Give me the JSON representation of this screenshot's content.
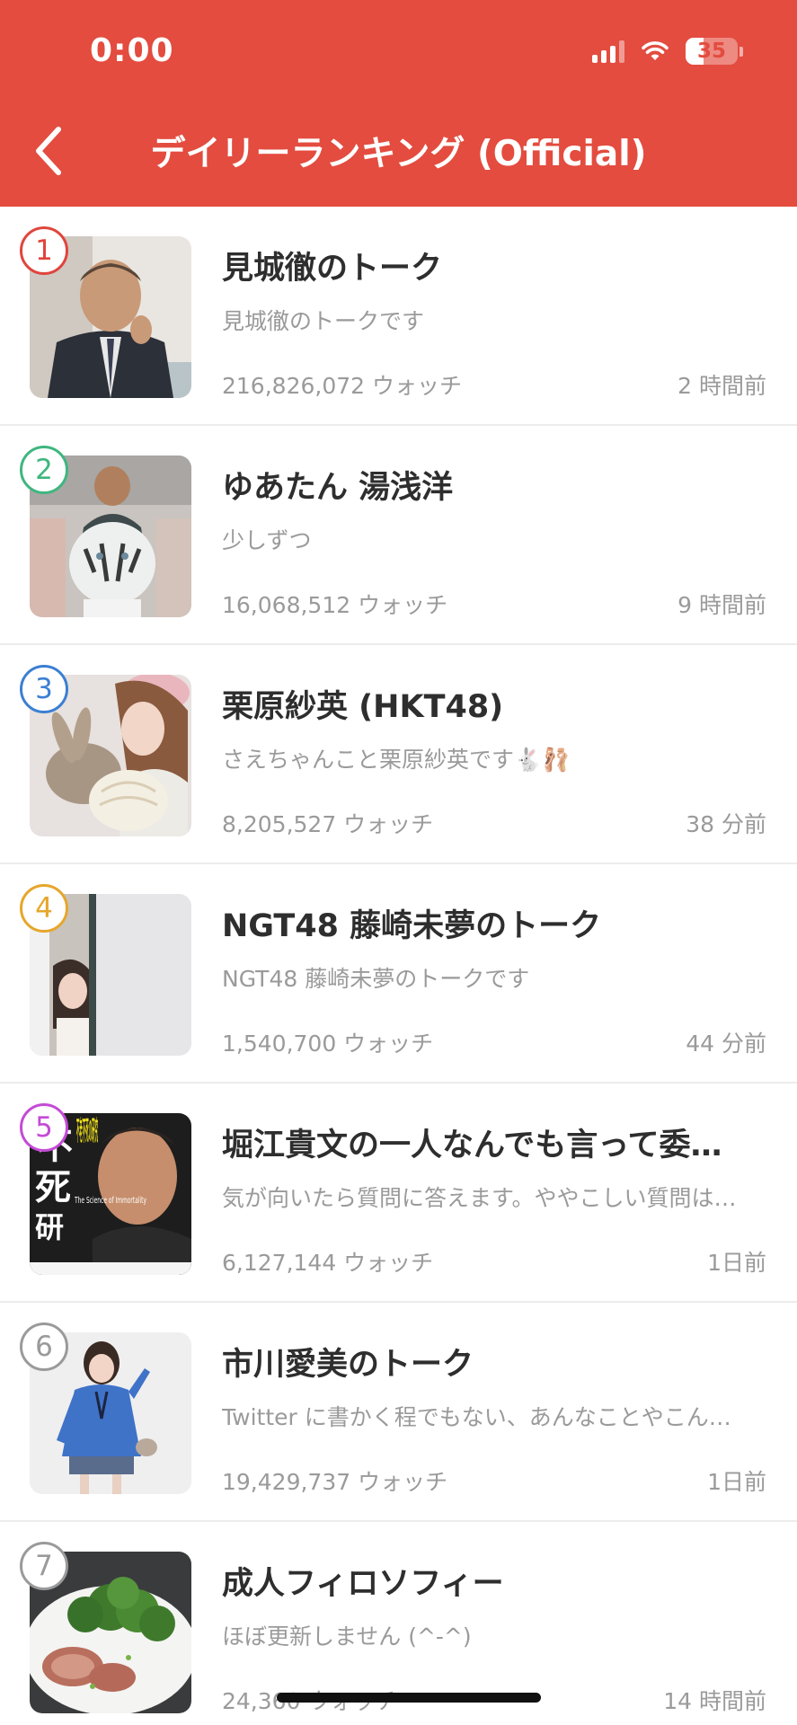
{
  "status_bar": {
    "time": "0:00",
    "battery": "35",
    "battery_level": 0.35
  },
  "header": {
    "title": "デイリーランキング (Official)",
    "background": "#e34c3f"
  },
  "rank_colors": [
    "#e0453c",
    "#3fb67f",
    "#3b7fd2",
    "#e6a62b",
    "#c44bd6",
    "#9a9a9a",
    "#9a9a9a"
  ],
  "items": [
    {
      "rank": "1",
      "title": "見城徹のトーク",
      "desc": "見城徹のトークです",
      "watch": "216,826,072 ウォッチ",
      "time": "2 時間前"
    },
    {
      "rank": "2",
      "title": "ゆあたん 湯浅洋",
      "desc": "少しずつ",
      "watch": "16,068,512 ウォッチ",
      "time": "9 時間前"
    },
    {
      "rank": "3",
      "title": "栗原紗英 (HKT48)",
      "desc": "さえちゃんこと栗原紗英です🐇🩰",
      "watch": "8,205,527 ウォッチ",
      "time": "38 分前"
    },
    {
      "rank": "4",
      "title": "NGT48 藤崎未夢のトーク",
      "desc": "NGT48 藤崎未夢のトークです",
      "watch": "1,540,700 ウォッチ",
      "time": "44 分前"
    },
    {
      "rank": "5",
      "title": "堀江貴文の一人なんでも言って委…",
      "desc": "気が向いたら質問に答えます。ややこしい質問は…",
      "watch": "6,127,144 ウォッチ",
      "time": "1日前"
    },
    {
      "rank": "6",
      "title": "市川愛美のトーク",
      "desc": "Twitter に書かく程でもない、あんなことやこん…",
      "watch": "19,429,737 ウォッチ",
      "time": "1日前"
    },
    {
      "rank": "7",
      "title": "成人フィロソフィー",
      "desc": "ほぼ更新しません (^-^)",
      "watch": "24,360 ウォッチ",
      "time": "14 時間前"
    }
  ],
  "thumb_book": {
    "title": "不老不死の研究",
    "sub": "The Science of Immortality"
  }
}
